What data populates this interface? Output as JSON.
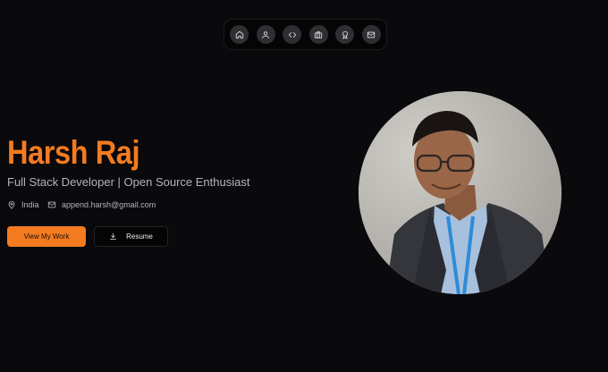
{
  "nav": {
    "items": [
      {
        "icon": "home-icon"
      },
      {
        "icon": "user-icon"
      },
      {
        "icon": "code-icon"
      },
      {
        "icon": "briefcase-icon"
      },
      {
        "icon": "award-icon"
      },
      {
        "icon": "mail-icon"
      }
    ]
  },
  "hero": {
    "name": "Harsh Raj",
    "tagline": "Full Stack Developer | Open Source Enthusiast",
    "location": "India",
    "email": "append.harsh@gmail.com",
    "primary_button": "View My Work",
    "secondary_button": "Resume"
  },
  "colors": {
    "background": "#0a090c",
    "accent": "#f47b20",
    "muted_text": "#b5b5b9"
  }
}
